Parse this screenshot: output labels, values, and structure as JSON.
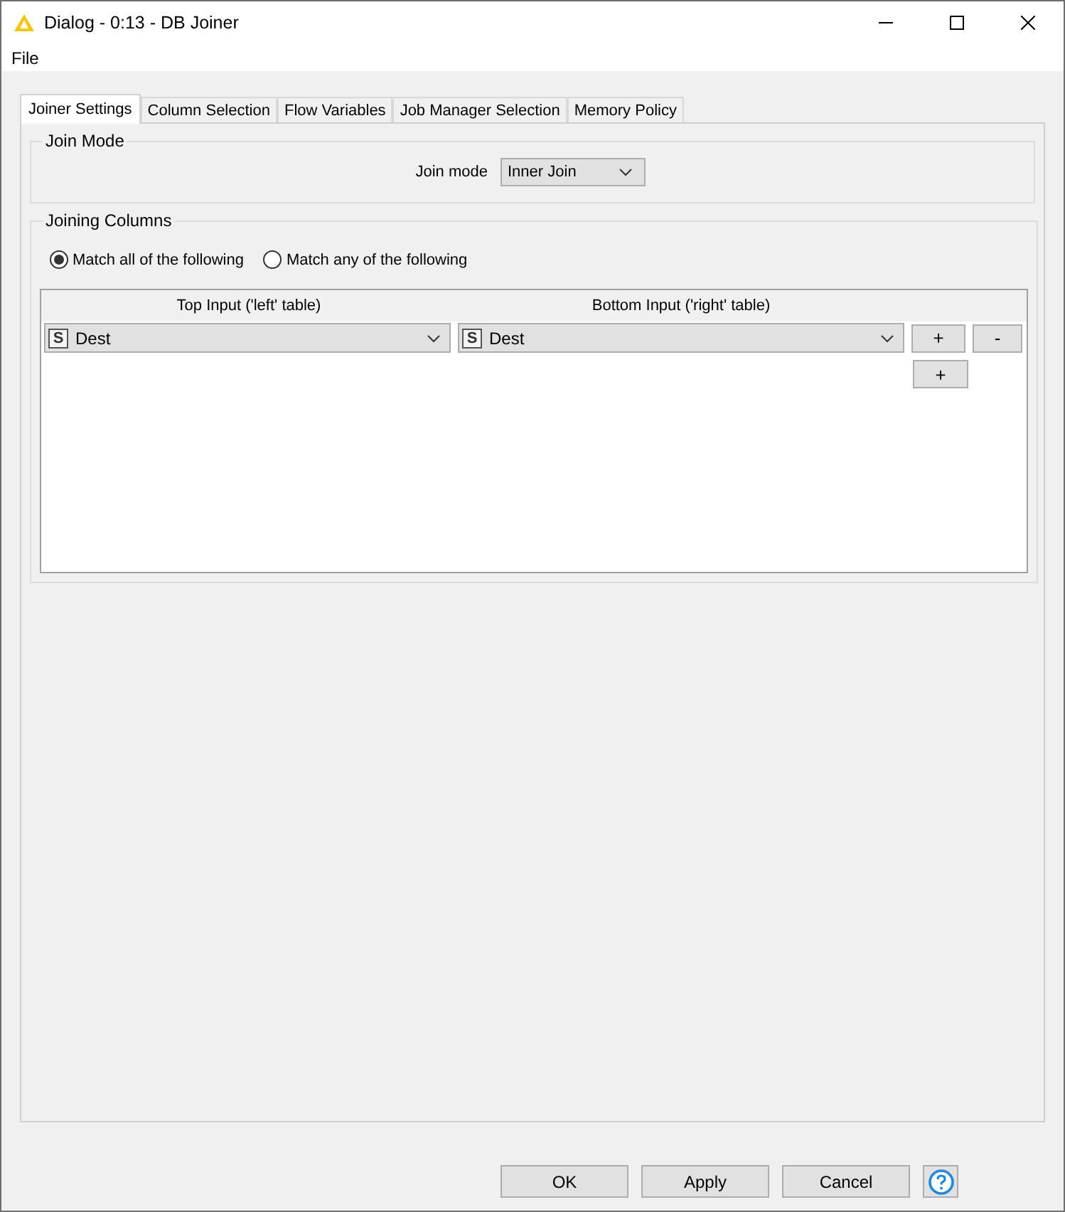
{
  "window": {
    "title": "Dialog - 0:13 - DB Joiner"
  },
  "menu": [
    "File"
  ],
  "tabs": [
    {
      "label": "Joiner Settings",
      "selected": true
    },
    {
      "label": "Column Selection",
      "selected": false
    },
    {
      "label": "Flow Variables",
      "selected": false
    },
    {
      "label": "Job Manager Selection",
      "selected": false
    },
    {
      "label": "Memory Policy",
      "selected": false
    }
  ],
  "join_mode": {
    "title": "Join Mode",
    "label": "Join mode",
    "value": "Inner Join"
  },
  "joining_columns": {
    "title": "Joining Columns",
    "match_options": [
      {
        "label": "Match all of the following",
        "selected": true
      },
      {
        "label": "Match any of the following",
        "selected": false
      }
    ],
    "columns": [
      "Top Input ('left' table)",
      "Bottom Input ('right' table)"
    ],
    "rows": [
      {
        "left": {
          "type": "S",
          "value": "Dest"
        },
        "right": {
          "type": "S",
          "value": "Dest"
        },
        "add": "+",
        "remove": "-"
      }
    ],
    "add_button": "+"
  },
  "buttons": [
    "OK",
    "Apply",
    "Cancel"
  ]
}
